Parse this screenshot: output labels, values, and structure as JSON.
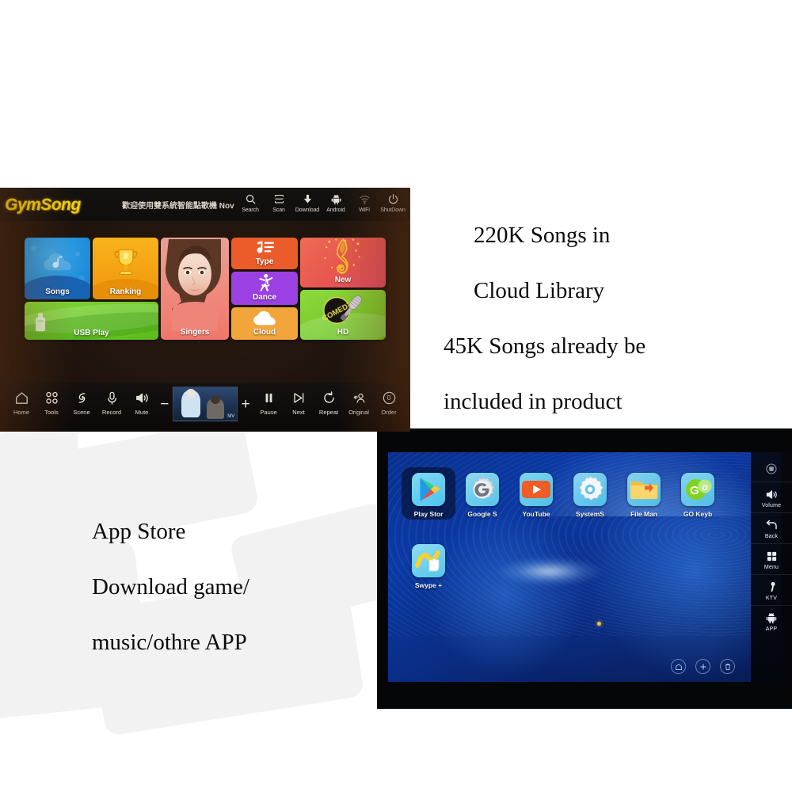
{
  "page": {
    "background_color": "#ffffff",
    "watermark_color": "#f2f2f2"
  },
  "karaoke_screen": {
    "brand_logo": "GymSong",
    "brand_color": "#f3d013",
    "welcome_text": "歡迎使用雙系統智能點歌機 Nov",
    "header_buttons": [
      {
        "label": "Search",
        "icon": "search-icon"
      },
      {
        "label": "Scan",
        "icon": "scan-icon"
      },
      {
        "label": "Download",
        "icon": "download-icon"
      },
      {
        "label": "Android",
        "icon": "android-icon"
      },
      {
        "label": "WiFi",
        "icon": "wifi-icon"
      },
      {
        "label": "ShutDown",
        "icon": "power-icon"
      }
    ],
    "tiles": [
      {
        "label": "Songs",
        "icon": "cloud-music-note-icon",
        "color": "#1b8ad8"
      },
      {
        "label": "Ranking",
        "icon": "trophy-icon",
        "color": "#f3a113"
      },
      {
        "label": "USB Play",
        "icon": "usb-drive-icon",
        "color": "#6cc827"
      },
      {
        "label": "Singers",
        "icon": "singer-portrait-image",
        "color": "#ef8d80"
      },
      {
        "label": "Type",
        "icon": "music-list-icon",
        "color": "#ec5c2b"
      },
      {
        "label": "Dance",
        "icon": "ballet-dancer-icon",
        "color": "#9b40e2"
      },
      {
        "label": "Cloud",
        "icon": "cloud-icon",
        "color": "#f2a53a"
      },
      {
        "label": "New",
        "icon": "treble-clef-icon",
        "color": "#e8564f"
      },
      {
        "label": "HD",
        "icon": "microphone-comedy-icon",
        "color": "#79cd2c"
      }
    ],
    "toolbar_left": [
      {
        "label": "Home",
        "icon": "home-icon"
      },
      {
        "label": "Tools",
        "icon": "grid-tools-icon"
      },
      {
        "label": "Scene",
        "icon": "scene-icon"
      },
      {
        "label": "Record",
        "icon": "microphone-icon"
      },
      {
        "label": "Mute",
        "icon": "speaker-icon"
      }
    ],
    "volume": {
      "decrease_label": "−",
      "increase_label": "+",
      "preview_caption": "MV"
    },
    "toolbar_right": [
      {
        "label": "Pause",
        "icon": "pause-icon"
      },
      {
        "label": "Next",
        "icon": "next-track-icon"
      },
      {
        "label": "Repeat",
        "icon": "repeat-icon"
      },
      {
        "label": "Original",
        "icon": "original-vocal-icon"
      },
      {
        "label": "Order",
        "icon": "order-count-icon",
        "badge": "0"
      }
    ]
  },
  "android_screen": {
    "apps_row1": [
      {
        "label": "Play Stor",
        "icon": "google-play-icon",
        "selected": true
      },
      {
        "label": "Google S",
        "icon": "google-settings-icon",
        "selected": false
      },
      {
        "label": "YouTube",
        "icon": "youtube-icon",
        "selected": false
      },
      {
        "label": "SystemS",
        "icon": "system-settings-icon",
        "selected": false
      },
      {
        "label": "File Man",
        "icon": "file-manager-icon",
        "selected": false
      },
      {
        "label": "GO Keyb",
        "icon": "go-keyboard-icon",
        "selected": false
      }
    ],
    "apps_row2": [
      {
        "label": "Swype +",
        "icon": "swype-icon",
        "selected": false
      }
    ],
    "sidebar": [
      {
        "label": "",
        "icon": "circle-record-icon"
      },
      {
        "label": "Volume",
        "icon": "volume-icon"
      },
      {
        "label": "Back",
        "icon": "back-arrow-icon"
      },
      {
        "label": "Menu",
        "icon": "menu-grid-icon"
      },
      {
        "label": "KTV",
        "icon": "ktv-microphone-icon"
      },
      {
        "label": "APP",
        "icon": "android-robot-icon"
      }
    ],
    "bottom_nav": [
      {
        "icon": "home-circle-icon"
      },
      {
        "icon": "plus-circle-icon"
      },
      {
        "icon": "trash-circle-icon"
      }
    ]
  },
  "captions": {
    "right_line1": "220K Songs in",
    "right_line2": "Cloud Library",
    "right_line3": "45K Songs already be",
    "right_line4": "included in product",
    "left_line1": "App Store",
    "left_line2": "Download game/",
    "left_line3": "music/othre APP"
  }
}
